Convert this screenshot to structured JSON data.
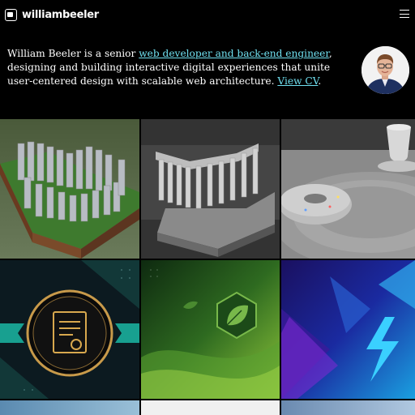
{
  "header": {
    "logo_text": "williambeeler",
    "logo_icon": "logo-mark-icon",
    "menu_icon": "hamburger-menu-icon"
  },
  "intro": {
    "text_before_link": "William Beeler is a senior ",
    "link_role": "web developer and back-end engineer",
    "text_after_link": ", designing and building interactive digital experiences that unite user-centered design with scalable web architecture. ",
    "link_cv": "View CV",
    "period": "."
  },
  "avatar": {
    "alt": "William Beeler"
  },
  "tiles": [
    {
      "name": "ancient-ruins-3d-tile"
    },
    {
      "name": "greek-temple-model-tile"
    },
    {
      "name": "donut-and-cup-render-tile"
    },
    {
      "name": "certificate-badge-tile"
    },
    {
      "name": "green-leaf-hexagon-tile"
    },
    {
      "name": "blue-lightning-tile"
    }
  ],
  "colors": {
    "link": "#6fe0f0",
    "background": "#000000"
  }
}
